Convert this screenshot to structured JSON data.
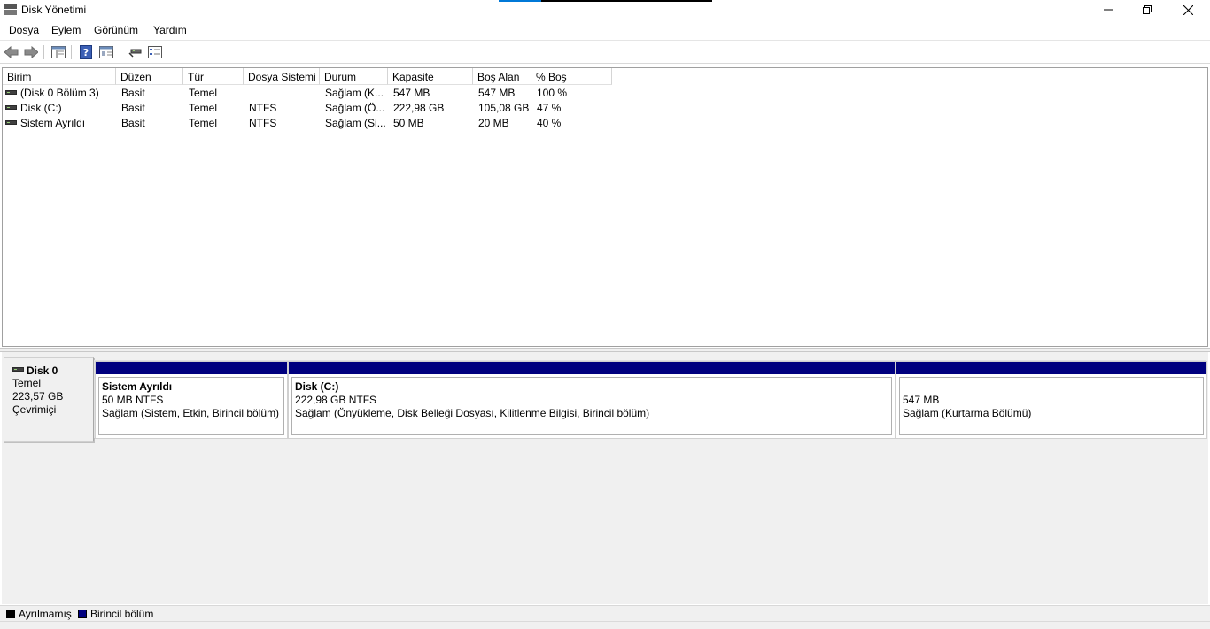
{
  "window": {
    "title": "Disk Yönetimi"
  },
  "menu": [
    "Dosya",
    "Eylem",
    "Görünüm",
    "Yardım"
  ],
  "toolbar": {
    "icons": [
      "back-arrow-icon",
      "forward-arrow-icon",
      "show-hide-tree-icon",
      "help-icon",
      "properties-icon",
      "connect-icon",
      "settings-icon"
    ]
  },
  "volume_list": {
    "columns": [
      "Birim",
      "Düzen",
      "Tür",
      "Dosya Sistemi",
      "Durum",
      "Kapasite",
      "Boş Alan",
      "% Boş"
    ],
    "rows": [
      [
        "(Disk 0 Bölüm 3)",
        "Basit",
        "Temel",
        "",
        "Sağlam (K...",
        "547 MB",
        "547 MB",
        "100 %"
      ],
      [
        "Disk (C:)",
        "Basit",
        "Temel",
        "NTFS",
        "Sağlam (Ö...",
        "222,98 GB",
        "105,08 GB",
        "47 %"
      ],
      [
        "Sistem Ayrıldı",
        "Basit",
        "Temel",
        "NTFS",
        "Sağlam (Si...",
        "50 MB",
        "20 MB",
        "40 %"
      ]
    ]
  },
  "disk": {
    "name": "Disk 0",
    "type": "Temel",
    "size": "223,57 GB",
    "status": "Çevrimiçi",
    "partitions": [
      {
        "name": "Sistem Ayrıldı",
        "size": "50 MB NTFS",
        "status": "Sağlam (Sistem, Etkin, Birincil bölüm)"
      },
      {
        "name": "Disk  (C:)",
        "size": "222,98 GB NTFS",
        "status": "Sağlam (Önyükleme, Disk Belleği Dosyası, Kilitlenme Bilgisi, Birincil bölüm)"
      },
      {
        "name": "",
        "size": "547 MB",
        "status": "Sağlam (Kurtarma Bölümü)"
      }
    ]
  },
  "legend": [
    {
      "label": "Ayrılmamış",
      "color": "#000000"
    },
    {
      "label": "Birincil bölüm",
      "color": "#00007f"
    }
  ],
  "colors": {
    "primary_partition": "#00007f",
    "unallocated": "#000000"
  }
}
